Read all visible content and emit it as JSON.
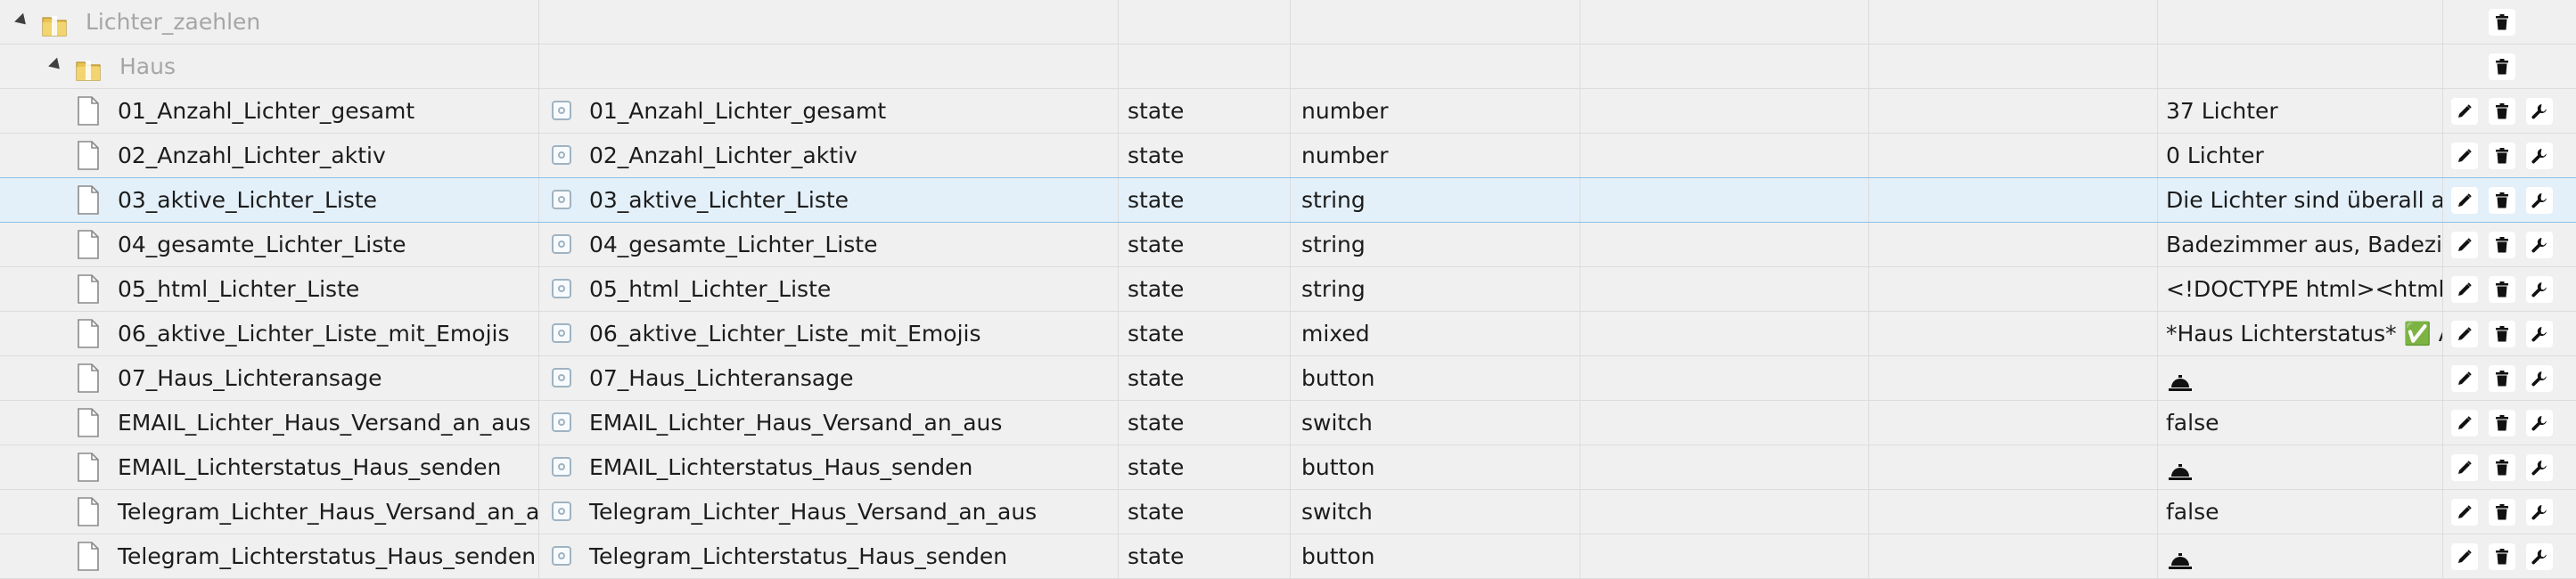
{
  "folders": [
    {
      "name": "Lichter_zaehlen"
    },
    {
      "name": "Haus"
    }
  ],
  "rows": [
    {
      "name": "01_Anzahl_Lichter_gesamt",
      "obj": "01_Anzahl_Lichter_gesamt",
      "type": "state",
      "role": "number",
      "value": "37 Lichter",
      "value_kind": "text"
    },
    {
      "name": "02_Anzahl_Lichter_aktiv",
      "obj": "02_Anzahl_Lichter_aktiv",
      "type": "state",
      "role": "number",
      "value": "0 Lichter",
      "value_kind": "text"
    },
    {
      "name": "03_aktive_Lichter_Liste",
      "obj": "03_aktive_Lichter_Liste",
      "type": "state",
      "role": "string",
      "value": "Die Lichter sind überall aus",
      "value_kind": "text",
      "selected": true
    },
    {
      "name": "04_gesamte_Lichter_Liste",
      "obj": "04_gesamte_Lichter_Liste",
      "type": "state",
      "role": "string",
      "value": "Badezimmer aus, Badezimmer",
      "value_kind": "text"
    },
    {
      "name": "05_html_Lichter_Liste",
      "obj": "05_html_Lichter_Liste",
      "type": "state",
      "role": "string",
      "value": "<!DOCTYPE html><html la",
      "value_kind": "text"
    },
    {
      "name": "06_aktive_Lichter_Liste_mit_Emojis",
      "obj": "06_aktive_Lichter_Liste_mit_Emojis",
      "type": "state",
      "role": "mixed",
      "value": "*Haus Lichterstatus* ✅ Al",
      "value_kind": "text"
    },
    {
      "name": "07_Haus_Lichteransage",
      "obj": "07_Haus_Lichteransage",
      "type": "state",
      "role": "button",
      "value": "",
      "value_kind": "bell"
    },
    {
      "name": "EMAIL_Lichter_Haus_Versand_an_aus",
      "obj": "EMAIL_Lichter_Haus_Versand_an_aus",
      "type": "state",
      "role": "switch",
      "value": "false",
      "value_kind": "text"
    },
    {
      "name": "EMAIL_Lichterstatus_Haus_senden",
      "obj": "EMAIL_Lichterstatus_Haus_senden",
      "type": "state",
      "role": "button",
      "value": "",
      "value_kind": "bell"
    },
    {
      "name": "Telegram_Lichter_Haus_Versand_an_aus",
      "obj": "Telegram_Lichter_Haus_Versand_an_aus",
      "type": "state",
      "role": "switch",
      "value": "false",
      "value_kind": "text"
    },
    {
      "name": "Telegram_Lichterstatus_Haus_senden",
      "obj": "Telegram_Lichterstatus_Haus_senden",
      "type": "state",
      "role": "button",
      "value": "",
      "value_kind": "bell"
    }
  ],
  "icons": {
    "folder": "folder-icon",
    "file": "file-icon",
    "object": "object-icon",
    "edit": "pencil-icon",
    "delete": "trash-icon",
    "settings": "wrench-icon",
    "button_value": "bell-icon"
  },
  "colors": {
    "row_bg": "#f0f0f0",
    "selected_bg": "#e3f0f9",
    "folder_text": "#a6a6a6",
    "folder_yellow": "#e8c352"
  }
}
